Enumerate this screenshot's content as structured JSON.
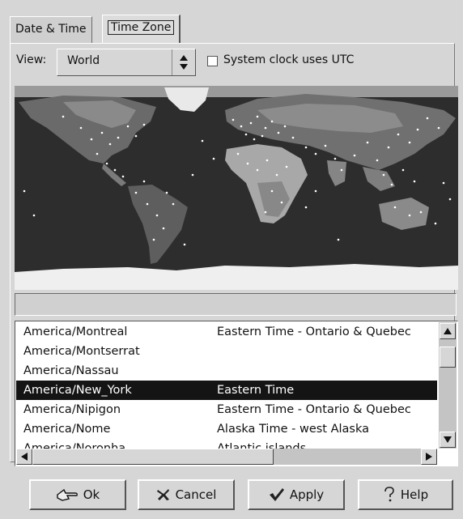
{
  "tabs": [
    {
      "label": "Date & Time",
      "active": false
    },
    {
      "label": "Time Zone",
      "active": true
    }
  ],
  "view": {
    "label": "View:",
    "selected": "World"
  },
  "utc_checkbox": {
    "label": "System clock uses UTC",
    "checked": false
  },
  "map": {
    "icon": "world-map"
  },
  "status_field": {
    "value": ""
  },
  "timezones": [
    {
      "zone": "America/Montreal",
      "description": "Eastern Time - Ontario & Quebec",
      "selected": false
    },
    {
      "zone": "America/Montserrat",
      "description": "",
      "selected": false
    },
    {
      "zone": "America/Nassau",
      "description": "",
      "selected": false
    },
    {
      "zone": "America/New_York",
      "description": "Eastern Time",
      "selected": true
    },
    {
      "zone": "America/Nipigon",
      "description": "Eastern Time - Ontario & Quebec",
      "selected": false
    },
    {
      "zone": "America/Nome",
      "description": "Alaska Time - west Alaska",
      "selected": false
    },
    {
      "zone": "America/Noronha",
      "description": "Atlantic islands",
      "selected": false
    }
  ],
  "buttons": {
    "ok": "Ok",
    "cancel": "Cancel",
    "apply": "Apply",
    "help": "Help"
  }
}
